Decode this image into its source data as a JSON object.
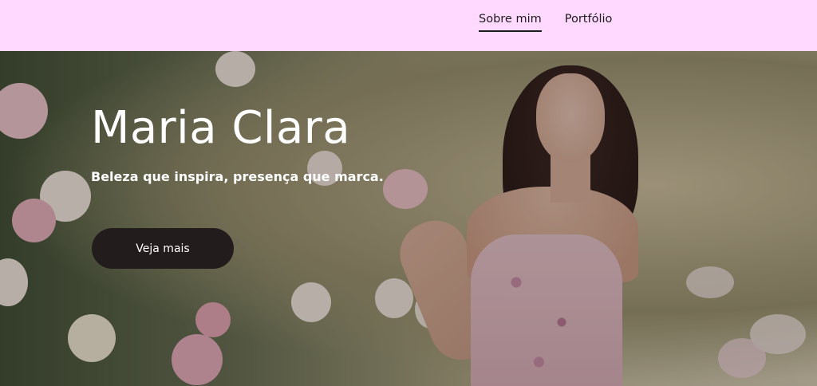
{
  "nav": {
    "items": [
      {
        "label": "Sobre mim",
        "active": true
      },
      {
        "label": "Portfólio",
        "active": false
      }
    ]
  },
  "hero": {
    "title": "Maria Clara",
    "subtitle": "Beleza que inspira, presença que marca.",
    "cta_label": "Veja mais"
  },
  "colors": {
    "header_bg": "#ffd9ff",
    "cta_bg": "#231c1c",
    "text_light": "#ffffff",
    "nav_text": "#1c1c1c"
  }
}
